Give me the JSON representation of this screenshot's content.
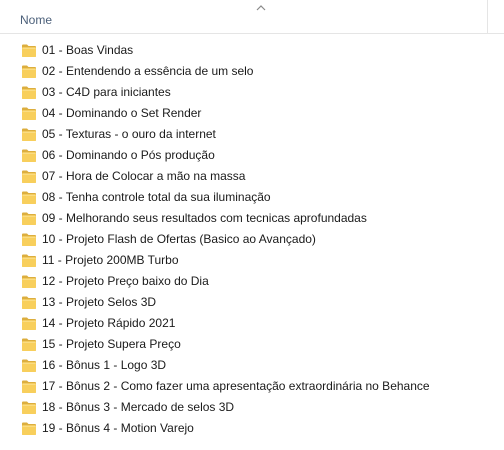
{
  "header": {
    "name_column": "Nome",
    "sort_indicator_icon": "chevron-up-icon"
  },
  "icons": {
    "folder": "folder-icon",
    "folder_color": "#f4c44e"
  },
  "files": [
    {
      "label": "01 - Boas Vindas"
    },
    {
      "label": "02 - Entendendo a essência de um selo"
    },
    {
      "label": "03 - C4D para iniciantes"
    },
    {
      "label": "04 - Dominando o Set Render"
    },
    {
      "label": "05 - Texturas - o ouro da internet"
    },
    {
      "label": "06 - Dominando o Pós produção"
    },
    {
      "label": "07 - Hora de Colocar a mão na massa"
    },
    {
      "label": "08 - Tenha controle total da sua iluminação"
    },
    {
      "label": "09 - Melhorando seus resultados com tecnicas aprofundadas"
    },
    {
      "label": "10 - Projeto Flash de Ofertas (Basico ao Avançado)"
    },
    {
      "label": "11 - Projeto 200MB Turbo"
    },
    {
      "label": "12 - Projeto Preço baixo do Dia"
    },
    {
      "label": "13 - Projeto Selos 3D"
    },
    {
      "label": "14 - Projeto Rápido 2021"
    },
    {
      "label": "15 - Projeto Supera Preço"
    },
    {
      "label": "16 - Bônus 1 - Logo 3D"
    },
    {
      "label": "17 - Bônus 2 - Como fazer uma apresentação extraordinária no Behance"
    },
    {
      "label": "18 - Bônus 3 - Mercado de selos 3D"
    },
    {
      "label": "19 - Bônus 4 - Motion Varejo"
    }
  ]
}
